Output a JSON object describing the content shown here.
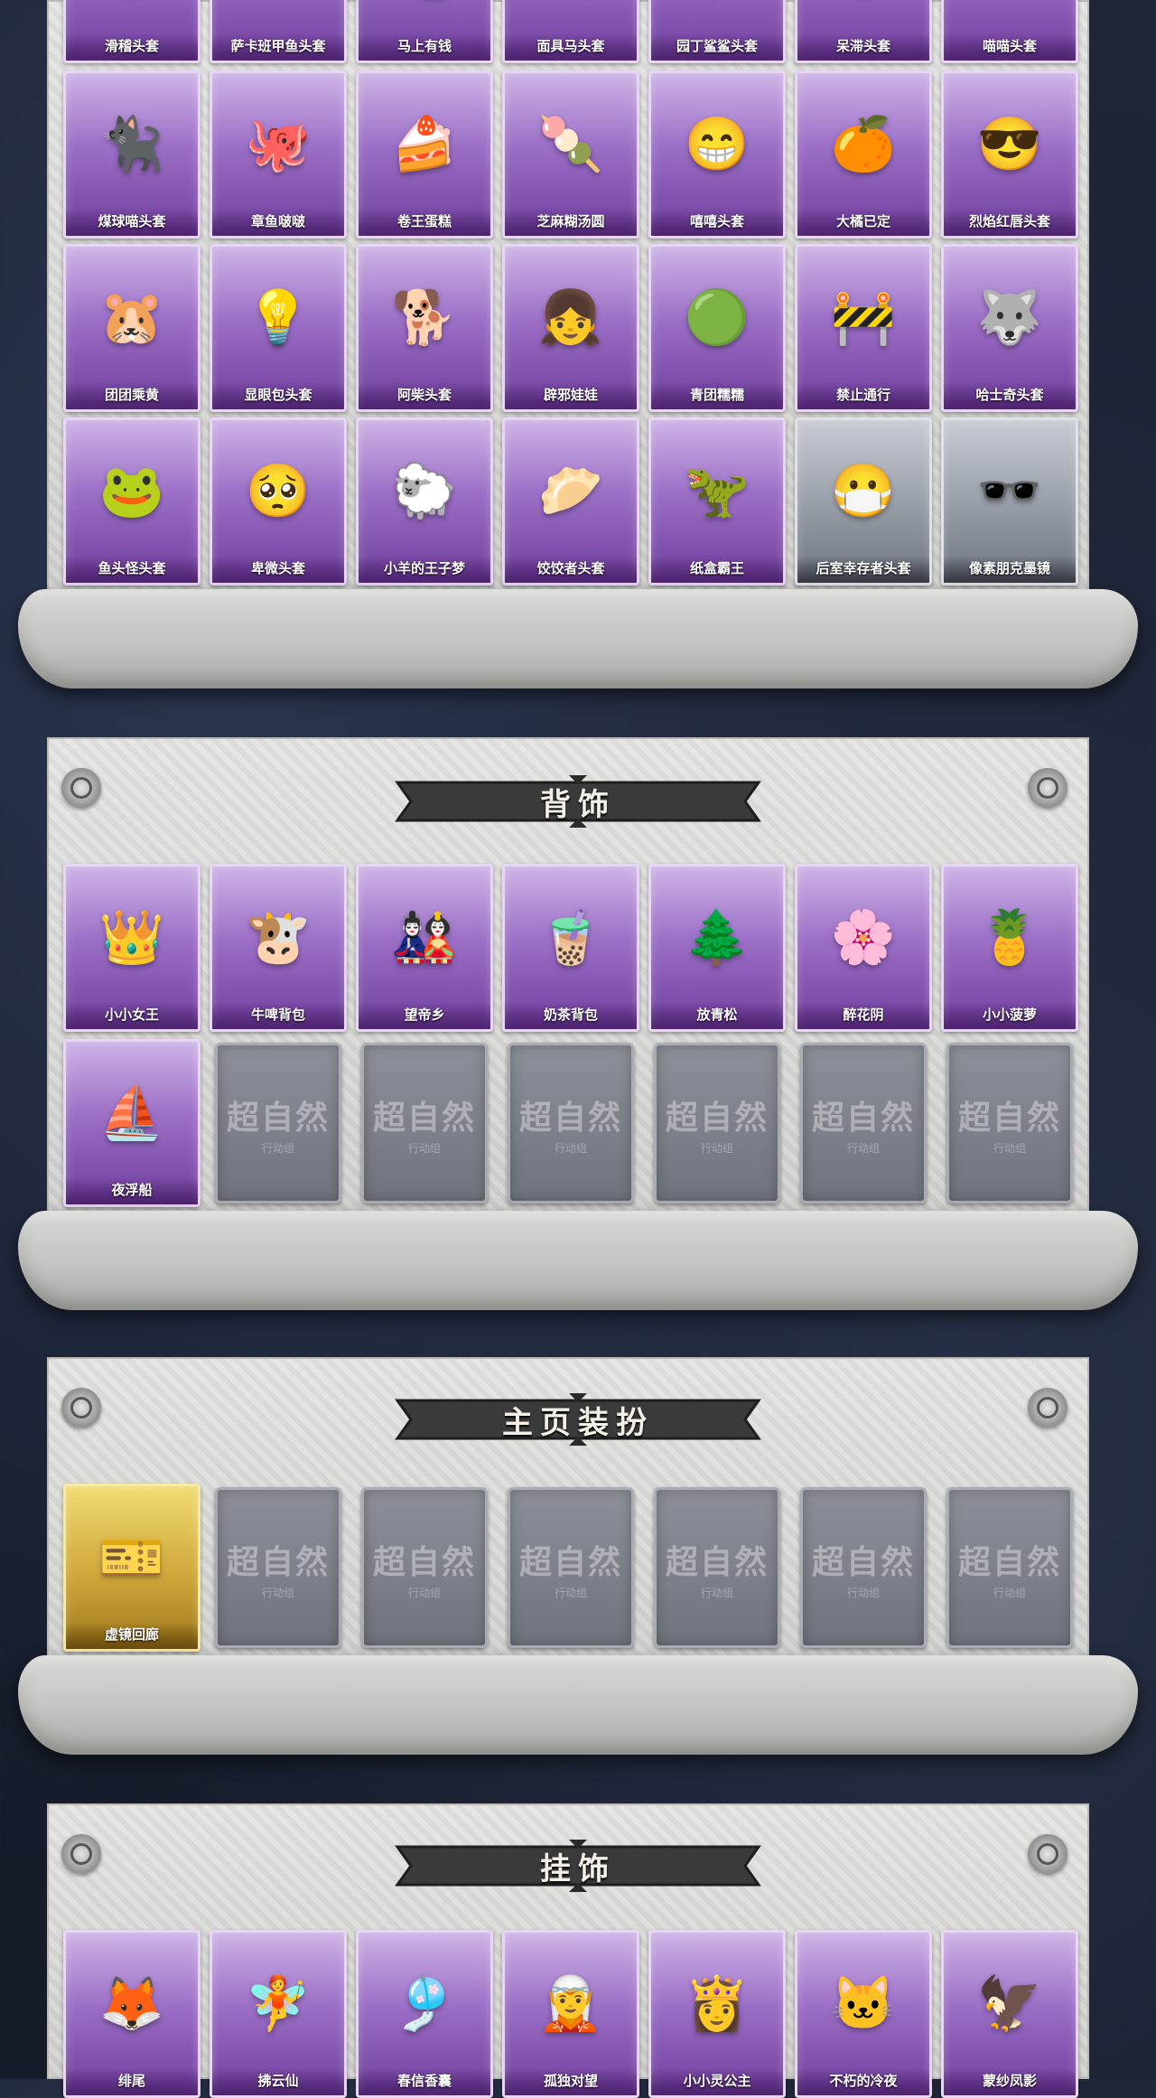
{
  "sections": {
    "headwear": {
      "rows": [
        [
          {
            "name": "滑稽头套",
            "icon": "🙃"
          },
          {
            "name": "萨卡班甲鱼头套",
            "icon": "🐟"
          },
          {
            "name": "马上有钱",
            "icon": "🐴"
          },
          {
            "name": "面具马头套",
            "icon": "🎭"
          },
          {
            "name": "园丁鲨鲨头套",
            "icon": "🦈"
          },
          {
            "name": "呆滞头套",
            "icon": "😐"
          },
          {
            "name": "喵喵头套",
            "icon": "🐱"
          }
        ],
        [
          {
            "name": "煤球喵头套",
            "icon": "🐈‍⬛"
          },
          {
            "name": "章鱼啵啵",
            "icon": "🐙"
          },
          {
            "name": "卷王蛋糕",
            "icon": "🍰"
          },
          {
            "name": "芝麻糊汤圆",
            "icon": "🍡"
          },
          {
            "name": "嘻嘻头套",
            "icon": "😁"
          },
          {
            "name": "大橘已定",
            "icon": "🍊"
          },
          {
            "name": "烈焰红唇头套",
            "icon": "😎"
          }
        ],
        [
          {
            "name": "团团乘黄",
            "icon": "🐹"
          },
          {
            "name": "显眼包头套",
            "icon": "💡"
          },
          {
            "name": "阿柴头套",
            "icon": "🐕"
          },
          {
            "name": "辟邪娃娃",
            "icon": "👧"
          },
          {
            "name": "青团糯糯",
            "icon": "🟢"
          },
          {
            "name": "禁止通行",
            "icon": "🚧"
          },
          {
            "name": "哈士奇头套",
            "icon": "🐺"
          }
        ],
        [
          {
            "name": "鱼头怪头套",
            "icon": "🐸",
            "style": "purple"
          },
          {
            "name": "卑微头套",
            "icon": "🥺",
            "style": "purple"
          },
          {
            "name": "小羊的王子梦",
            "icon": "🐑",
            "style": "purple"
          },
          {
            "name": "饺饺者头套",
            "icon": "🥟",
            "style": "purple"
          },
          {
            "name": "纸盒霸王",
            "icon": "🦖",
            "style": "purple"
          },
          {
            "name": "后室幸存者头套",
            "icon": "😷",
            "style": "gray"
          },
          {
            "name": "像素朋克墨镜",
            "icon": "🕶️",
            "style": "gray"
          }
        ]
      ]
    },
    "back": {
      "title": "背饰",
      "items": [
        {
          "name": "小小女王",
          "icon": "👑"
        },
        {
          "name": "牛啤背包",
          "icon": "🐮"
        },
        {
          "name": "望帝乡",
          "icon": "🎎"
        },
        {
          "name": "奶茶背包",
          "icon": "🧋"
        },
        {
          "name": "放青松",
          "icon": "🌲"
        },
        {
          "name": "醉花阴",
          "icon": "🌸"
        },
        {
          "name": "小小菠萝",
          "icon": "🍍"
        },
        {
          "name": "夜浮船",
          "icon": "⛵"
        }
      ],
      "placeholder": {
        "wm": "超自然",
        "sub": "行动组"
      },
      "empty_count": 6
    },
    "homepage": {
      "title": "主页装扮",
      "items": [
        {
          "name": "虚镜回廊",
          "icon": "🎫"
        }
      ],
      "placeholder": {
        "wm": "超自然",
        "sub": "行动组"
      },
      "empty_count": 6
    },
    "pendant": {
      "title": "挂饰",
      "items": [
        {
          "name": "绯尾",
          "icon": "🦊"
        },
        {
          "name": "拂云仙",
          "icon": "🧚"
        },
        {
          "name": "春信香囊",
          "icon": "🎐"
        },
        {
          "name": "孤独对望",
          "icon": "🧝"
        },
        {
          "name": "小小灵公主",
          "icon": "👸"
        },
        {
          "name": "不朽的冷夜",
          "icon": "🐱"
        },
        {
          "name": "蒙纱凤影",
          "icon": "🦅"
        }
      ]
    }
  }
}
